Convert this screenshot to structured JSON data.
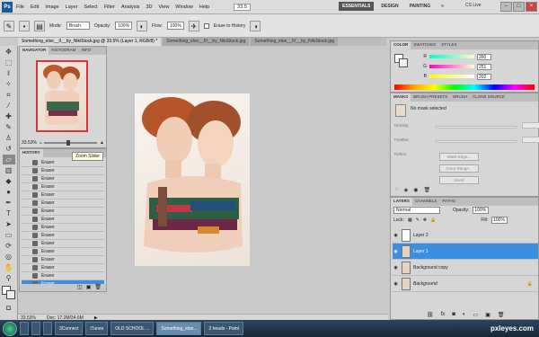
{
  "menubar": {
    "logo": "Ps",
    "menus": [
      "File",
      "Edit",
      "Image",
      "Layer",
      "Select",
      "Filter",
      "Analysis",
      "3D",
      "View",
      "Window",
      "Help"
    ],
    "zoom": "33.5",
    "workspaces": [
      "ESSENTIALS",
      "DESIGN",
      "PAINTING"
    ],
    "more": "»",
    "cslive": "CS Live"
  },
  "options": {
    "mode_label": "Mode:",
    "mode_value": "Brush",
    "opacity_label": "Opacity:",
    "opacity_value": "100%",
    "flow_label": "Flow:",
    "flow_value": "100%",
    "erase_history": "Erase to History"
  },
  "doc_tabs": [
    "Something_else__II__by_NikiStock.jpg @ 33.5% (Layer 1, RGB/8) *",
    "Something_else__III__by_NikiStock.jpg",
    "Something_else__IV__by_NikiStock.jpg"
  ],
  "navigator": {
    "tabs": [
      "NAVIGATOR",
      "HISTOGRAM",
      "INFO"
    ],
    "zoom": "33.53%"
  },
  "tooltip": "Zoom Slider",
  "history": {
    "title": "HISTORY",
    "items": [
      "Eraser",
      "Eraser",
      "Eraser",
      "Eraser",
      "Eraser",
      "Eraser",
      "Eraser",
      "Eraser",
      "Eraser",
      "Eraser",
      "Eraser",
      "Eraser",
      "Eraser",
      "Eraser",
      "Eraser",
      "Eraser"
    ],
    "selected_index": 15
  },
  "status": {
    "zoom": "33.53%",
    "doc": "Doc: 17.2M/34.6M"
  },
  "color": {
    "tabs": [
      "COLOR",
      "SWATCHES",
      "STYLES"
    ],
    "r_label": "R",
    "r_value": "260",
    "g_label": "G",
    "g_value": "251",
    "b_label": "B",
    "b_value": "202"
  },
  "masks": {
    "tabs": [
      "MASKS",
      "BRUSH PRESETS",
      "BRUSH",
      "CLONE SOURCE"
    ],
    "status": "No mask selected",
    "density": "Density:",
    "feather": "Feather:",
    "refine": "Refine:",
    "mask_edge": "Mask Edge...",
    "color_range": "Color Range...",
    "invert": "Invert"
  },
  "layers": {
    "tabs": [
      "LAYERS",
      "CHANNELS",
      "PATHS"
    ],
    "blend": "Normal",
    "opacity_label": "Opacity:",
    "opacity_value": "100%",
    "lock_label": "Lock:",
    "fill_label": "Fill:",
    "fill_value": "100%",
    "items": [
      "Layer 2",
      "Layer 1",
      "Background copy",
      "Background"
    ],
    "selected_index": 1
  },
  "taskbar": {
    "items": [
      "3Connect",
      "iTunes",
      "OLD SCHOOL ...",
      "Something_else...",
      "2 heads - Paint"
    ],
    "active_index": 3
  },
  "watermark": "pxleyes.com",
  "colors": {
    "selection": "#3b8ee0",
    "nav_frame": "#dd3333"
  }
}
